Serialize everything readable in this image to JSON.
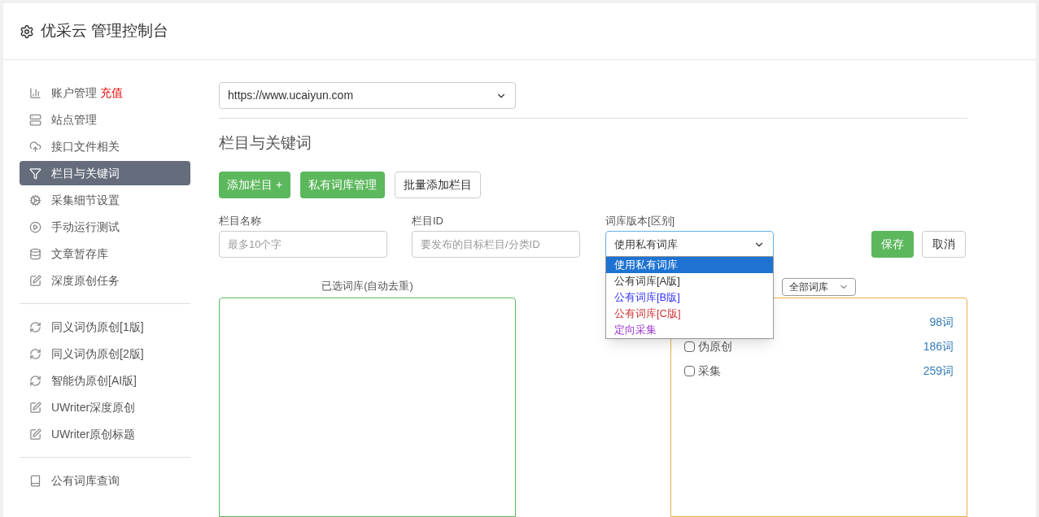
{
  "header": {
    "title": "优采云 管理控制台"
  },
  "sidebar": {
    "groups": [
      [
        {
          "label": "账户管理",
          "badge": "充值",
          "selected": false
        },
        {
          "label": "站点管理",
          "selected": false
        },
        {
          "label": "接口文件相关",
          "selected": false
        },
        {
          "label": "栏目与关键词",
          "selected": true
        },
        {
          "label": "采集细节设置",
          "selected": false
        },
        {
          "label": "手动运行测试",
          "selected": false
        },
        {
          "label": "文章暂存库",
          "selected": false
        },
        {
          "label": "深度原创任务",
          "selected": false
        }
      ],
      [
        {
          "label": "同义词伪原创[1版]",
          "selected": false
        },
        {
          "label": "同义词伪原创[2版]",
          "selected": false
        },
        {
          "label": "智能伪原创[AI版]",
          "selected": false
        },
        {
          "label": "UWriter深度原创",
          "selected": false
        },
        {
          "label": "UWriter原创标题",
          "selected": false
        }
      ],
      [
        {
          "label": "公有词库查询",
          "selected": false
        }
      ]
    ]
  },
  "site_select": {
    "value": "https://www.ucaiyun.com"
  },
  "section_title": "栏目与关键词",
  "buttons": [
    {
      "label": "添加栏目 +",
      "kind": "primary"
    },
    {
      "label": "私有词库管理",
      "kind": "primary"
    },
    {
      "label": "批量添加栏目",
      "kind": "default"
    }
  ],
  "form": {
    "name": {
      "label": "栏目名称",
      "placeholder": "最多10个字"
    },
    "id": {
      "label": "栏目ID",
      "placeholder": "要发布的目标栏目/分类ID"
    },
    "version": {
      "label": "词库版本[区别]",
      "value": "使用私有词库",
      "expanded": true,
      "options": [
        {
          "label": "使用私有词库",
          "selected": true
        },
        {
          "label": "公有词库[A版]",
          "selected": false,
          "color": "#333333"
        },
        {
          "label": "公有词库[B版]",
          "selected": false,
          "color": "#3333ff"
        },
        {
          "label": "公有词库[C版]",
          "selected": false,
          "color": "#cc3333"
        },
        {
          "label": "定向采集",
          "selected": false,
          "color": "#9933cc"
        }
      ]
    },
    "save": "保存",
    "cancel": "取消"
  },
  "selected_panel": {
    "title": "已选词库(自动去重)"
  },
  "library_panel": {
    "filter": "全部词库",
    "rows": [
      {
        "label": null,
        "count": "98词"
      },
      {
        "label": "伪原创",
        "count": "186词",
        "checked": false
      },
      {
        "label": "采集",
        "count": "259词",
        "checked": false
      }
    ]
  }
}
